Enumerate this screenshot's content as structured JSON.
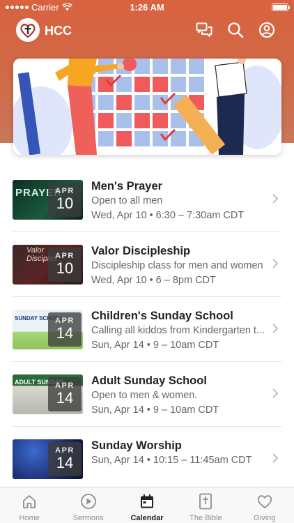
{
  "status_bar": {
    "carrier": "Carrier",
    "time": "1:26 AM"
  },
  "app": {
    "name": "HCC"
  },
  "colors": {
    "header": "#d9623f",
    "active_tab": "#222222",
    "inactive_tab": "#8e8e8e"
  },
  "top_icons": [
    "chat-icon",
    "search-icon",
    "account-icon"
  ],
  "events": [
    {
      "title": "Men's Prayer",
      "description": "Open to all men",
      "when": "Wed, Apr 10 • 6:30 – 7:30am CDT",
      "month": "APR",
      "day": "10",
      "thumb_text": "PRAYER"
    },
    {
      "title": "Valor Discipleship",
      "description": "Discipleship class for men and women",
      "when": "Wed, Apr 10 • 6 – 8pm CDT",
      "month": "APR",
      "day": "10",
      "thumb_text": "Valor Disciples"
    },
    {
      "title": "Children's Sunday School",
      "description": "Calling all kiddos from Kindergarten t...",
      "when": "Sun, Apr 14 • 9 – 10am CDT",
      "month": "APR",
      "day": "14",
      "thumb_text": "SUNDAY SCHOOL"
    },
    {
      "title": "Adult Sunday School",
      "description": "Open to men & women.",
      "when": "Sun, Apr 14 • 9 – 10am CDT",
      "month": "APR",
      "day": "14",
      "thumb_text": "ADULT SUNDAY"
    },
    {
      "title": "Sunday Worship",
      "description": "",
      "when": "Sun, Apr 14 • 10:15 – 11:45am CDT",
      "month": "APR",
      "day": "14",
      "thumb_text": ""
    }
  ],
  "tabs": [
    {
      "label": "Home",
      "icon": "home-icon",
      "active": false
    },
    {
      "label": "Sermons",
      "icon": "play-icon",
      "active": false
    },
    {
      "label": "Calendar",
      "icon": "calendar-icon",
      "active": true
    },
    {
      "label": "The Bible",
      "icon": "bible-icon",
      "active": false
    },
    {
      "label": "Giving",
      "icon": "heart-icon",
      "active": false
    }
  ]
}
